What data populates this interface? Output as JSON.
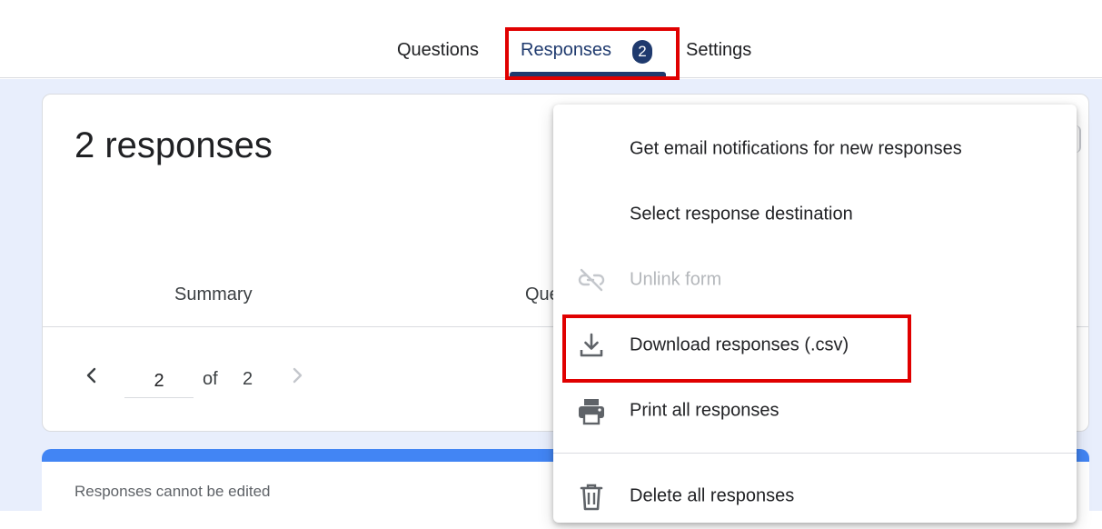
{
  "tabs": {
    "questions": "Questions",
    "responses": "Responses",
    "responses_count": "2",
    "settings": "Settings"
  },
  "summary": {
    "title": "2 responses",
    "subtab_summary": "Summary",
    "subtab_question_partial": "Question"
  },
  "pager": {
    "current_page": "2",
    "of_label": "of",
    "total_pages": "2"
  },
  "notice": {
    "text": "Responses cannot be edited"
  },
  "menu": {
    "items": [
      {
        "label": "Get email notifications for new responses",
        "icon": "none",
        "enabled": true
      },
      {
        "label": "Select response destination",
        "icon": "none",
        "enabled": true
      },
      {
        "label": "Unlink form",
        "icon": "link-off-icon",
        "enabled": false
      },
      {
        "label": "Download responses (.csv)",
        "icon": "download-icon",
        "enabled": true
      },
      {
        "label": "Print all responses",
        "icon": "printer-icon",
        "enabled": true
      },
      {
        "label": "Delete all responses",
        "icon": "trash-icon",
        "enabled": true
      }
    ]
  },
  "colors": {
    "accent": "#1f3a6e",
    "highlight_box": "#e00000",
    "canvas_bg": "#e8eefc",
    "card_top_bar": "#4285f4"
  }
}
